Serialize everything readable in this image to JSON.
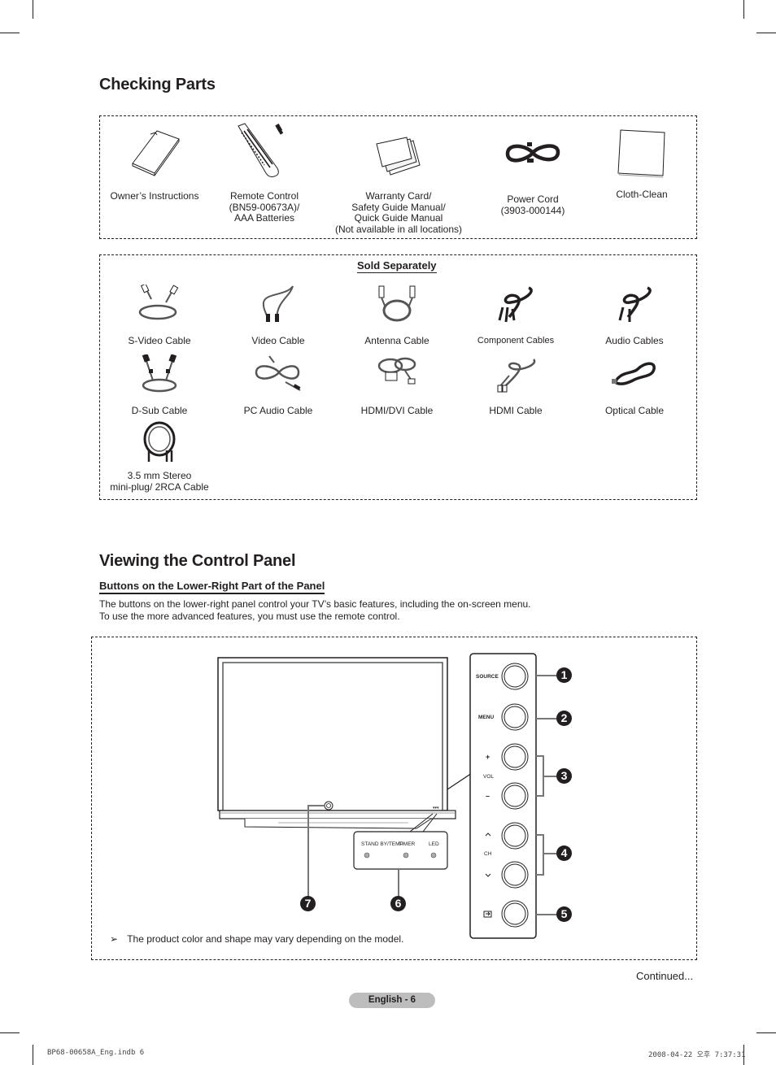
{
  "checking_parts": {
    "title": "Checking Parts",
    "included": [
      {
        "icon": "manual-icon",
        "label": "Owner’s Instructions"
      },
      {
        "icon": "remote-control-icon",
        "label": "Remote Control\n(BN59-00673A)/\nAAA Batteries"
      },
      {
        "icon": "warranty-cards-icon",
        "label": "Warranty Card/\nSafety Guide Manual/\nQuick Guide Manual\n(Not available in all locations)"
      },
      {
        "icon": "power-cord-icon",
        "label": "Power Cord\n(3903-000144)"
      },
      {
        "icon": "cloth-icon",
        "label": "Cloth-Clean"
      }
    ],
    "sold_separately": {
      "title": "Sold Separately",
      "items": [
        {
          "icon": "s-video-cable-icon",
          "label": "S-Video Cable"
        },
        {
          "icon": "video-cable-icon",
          "label": "Video Cable"
        },
        {
          "icon": "antenna-cable-icon",
          "label": "Antenna Cable"
        },
        {
          "icon": "component-cables-icon",
          "label": "Component Cables"
        },
        {
          "icon": "audio-cables-icon",
          "label": "Audio Cables"
        },
        {
          "icon": "d-sub-cable-icon",
          "label": "D-Sub Cable"
        },
        {
          "icon": "pc-audio-cable-icon",
          "label": "PC Audio Cable"
        },
        {
          "icon": "hdmi-dvi-cable-icon",
          "label": "HDMI/DVI Cable"
        },
        {
          "icon": "hdmi-cable-icon",
          "label": "HDMI Cable"
        },
        {
          "icon": "optical-cable-icon",
          "label": "Optical Cable"
        },
        {
          "icon": "stereo-rca-cable-icon",
          "label": "3.5 mm Stereo\nmini-plug/ 2RCA Cable"
        }
      ]
    }
  },
  "control_panel": {
    "title": "Viewing the Control Panel",
    "subheading": "Buttons on the Lower-Right Part of the Panel",
    "description_line1": "The buttons on the lower-right panel control your TV’s basic features, including the on-screen menu.",
    "description_line2": "To use the more advanced features, you must use the remote control.",
    "buttons": {
      "source": "SOURCE",
      "menu": "MENU",
      "vol_plus": "+",
      "vol": "VOL",
      "vol_minus": "–",
      "ch": "CH"
    },
    "indicators": {
      "standby": "STAND BY/TEMP",
      "timer": "TIMER",
      "led": "LED"
    },
    "callouts": [
      "1",
      "2",
      "3",
      "4",
      "5",
      "6",
      "7"
    ],
    "note_arrow": "➢",
    "note": "The product color and shape may vary depending on the model."
  },
  "footer": {
    "continued": "Continued...",
    "page_label": "English - 6",
    "file_name": "BP68-00658A_Eng.indb   6",
    "timestamp": "2008-04-22   오후 7:37:31"
  }
}
